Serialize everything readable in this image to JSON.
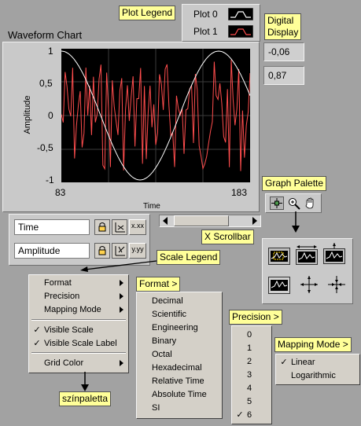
{
  "chart": {
    "title": "Waveform Chart",
    "ylabel": "Amplitude",
    "xlabel": "Time",
    "yticks": [
      "1",
      "0,5",
      "0",
      "-0,5",
      "-1"
    ],
    "xticks": [
      "83",
      "183"
    ]
  },
  "legend": {
    "plots": [
      {
        "name": "Plot 0",
        "color": "#ffffff"
      },
      {
        "name": "Plot 1",
        "color": "#ff4d4d"
      }
    ]
  },
  "digital_display": {
    "values": [
      "-0,06",
      "0,87"
    ]
  },
  "scale_legend": {
    "fields": [
      "Time",
      "Amplitude"
    ],
    "x_scale_button": "x.xx",
    "y_scale_button": "y.yy"
  },
  "callouts": {
    "plot_legend": "Plot Legend",
    "digital_display": "Digital\nDisplay",
    "graph_palette": "Graph Palette",
    "x_scrollbar": "X Scrollbar",
    "scale_legend": "Scale Legend",
    "format_menu": "Format >",
    "precision_menu": "Precision >",
    "mapping_menu": "Mapping Mode >",
    "color_palette": "színpaletta"
  },
  "context_menu": {
    "items": [
      {
        "label": "Format",
        "checked": false,
        "submenu": true
      },
      {
        "label": "Precision",
        "checked": false,
        "submenu": true
      },
      {
        "label": "Mapping Mode",
        "checked": false,
        "submenu": true
      },
      {
        "label": "Visible Scale",
        "checked": true,
        "submenu": false
      },
      {
        "label": "Visible Scale Label",
        "checked": true,
        "submenu": false
      },
      {
        "label": "Grid Color",
        "checked": false,
        "submenu": true
      }
    ]
  },
  "format_options": [
    "Decimal",
    "Scientific",
    "Engineering",
    "Binary",
    "Octal",
    "Hexadecimal",
    "Relative Time",
    "Absolute Time",
    "SI"
  ],
  "precision_options": {
    "values": [
      "0",
      "1",
      "2",
      "3",
      "4",
      "5",
      "6"
    ],
    "selected": "6"
  },
  "mapping_options": {
    "values": [
      "Linear",
      "Logarithmic"
    ],
    "selected": "Linear"
  },
  "icons": {
    "palette": [
      "cursor-move-icon",
      "zoom-icon",
      "pan-hand-icon"
    ],
    "zoom_palette": [
      "zoom-rect-icon",
      "zoom-x-icon",
      "zoom-y-icon",
      "zoom-fit-icon",
      "zoom-in-point-icon",
      "zoom-out-point-icon"
    ]
  },
  "colors": {
    "plot_bg": "#000000",
    "sine": "#ffffff",
    "noise": "#ff4d4d",
    "callout": "#ffff99"
  }
}
